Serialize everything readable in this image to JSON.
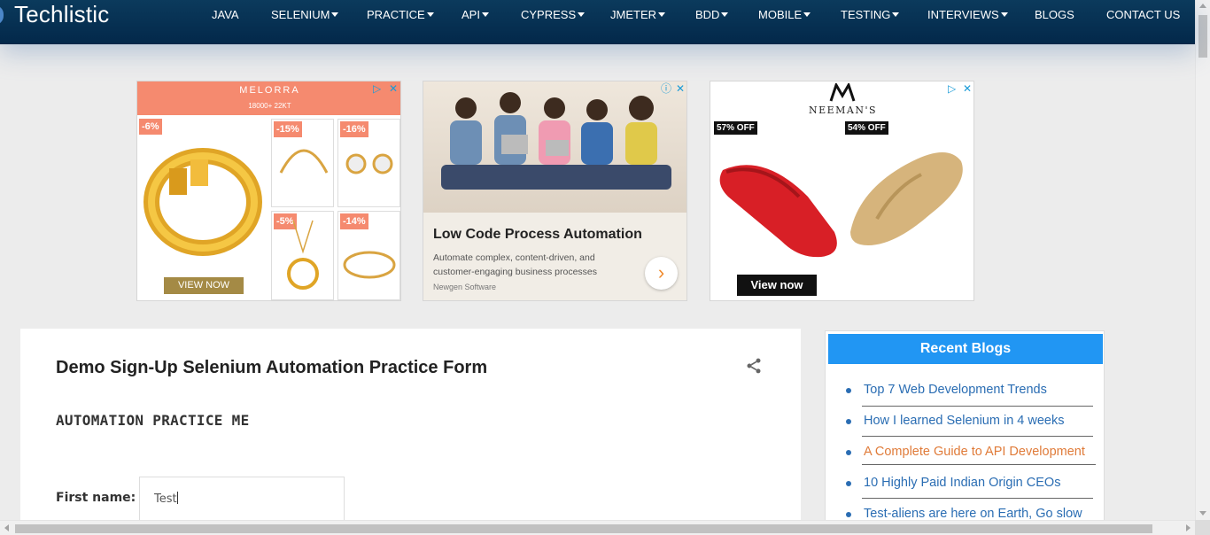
{
  "brand": {
    "name": "Techlistic"
  },
  "nav": [
    {
      "label": "JAVA",
      "dropdown": false
    },
    {
      "label": "SELENIUM",
      "dropdown": true
    },
    {
      "label": "PRACTICE",
      "dropdown": true
    },
    {
      "label": "API",
      "dropdown": true
    },
    {
      "label": "CYPRESS",
      "dropdown": true
    },
    {
      "label": "JMETER",
      "dropdown": true
    },
    {
      "label": "BDD",
      "dropdown": true
    },
    {
      "label": "MOBILE",
      "dropdown": true
    },
    {
      "label": "TESTING",
      "dropdown": true
    },
    {
      "label": "INTERVIEWS",
      "dropdown": true
    },
    {
      "label": "BLOGS",
      "dropdown": false
    },
    {
      "label": "CONTACT US",
      "dropdown": false
    }
  ],
  "ads": {
    "melorra": {
      "brand": "MELORRA",
      "sub": "18000+   22KT",
      "discounts": [
        "-6%",
        "-15%",
        "-16%",
        "-5%",
        "-14%"
      ],
      "cta": "VIEW NOW"
    },
    "newgen": {
      "title": "Low Code Process Automation",
      "desc": "Automate complex, content-driven, and customer-engaging business processes",
      "source": "Newgen Software",
      "cta_icon": "chevron-right-icon"
    },
    "neemans": {
      "brand": "NEEMAN'S",
      "offers": [
        "57% OFF",
        "54% OFF"
      ],
      "cta": "View now"
    }
  },
  "main": {
    "title": "Demo Sign-Up Selenium Automation Practice Form",
    "subheading": "AUTOMATION PRACTICE ME",
    "first_name_label": "First name:",
    "first_name_value": "Test"
  },
  "sidebar": {
    "heading": "Recent Blogs",
    "items": [
      {
        "label": "Top 7 Web Development Trends",
        "color": "#2a6db3"
      },
      {
        "label": "How I learned Selenium in 4 weeks",
        "color": "#2a6db3"
      },
      {
        "label": "A Complete Guide to API Development",
        "color": "#e07b39"
      },
      {
        "label": "10 Highly Paid Indian Origin CEOs",
        "color": "#2a6db3"
      },
      {
        "label": "Test-aliens are here on Earth, Go slow",
        "color": "#2a6db3"
      }
    ]
  },
  "colors": {
    "nav_bg": "#03284a",
    "accent": "#2196f3",
    "link": "#2a6db3",
    "link_visited": "#e07b39"
  }
}
